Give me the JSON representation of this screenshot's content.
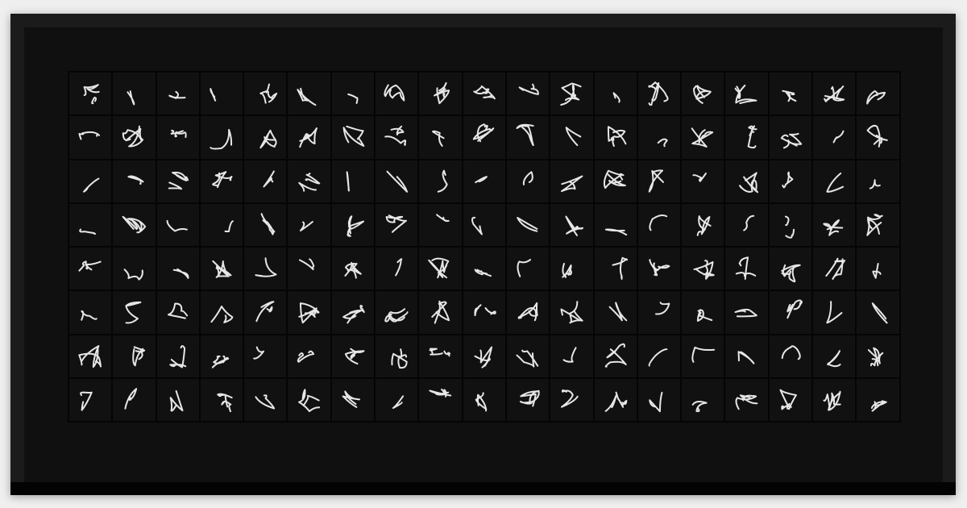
{
  "grid": {
    "rows": 8,
    "cols": 19
  },
  "colors": {
    "background": "#efefef",
    "frame": "#1b1b1b",
    "panel": "#101010",
    "cell": "#111111",
    "stroke": "#e6e6e6"
  }
}
